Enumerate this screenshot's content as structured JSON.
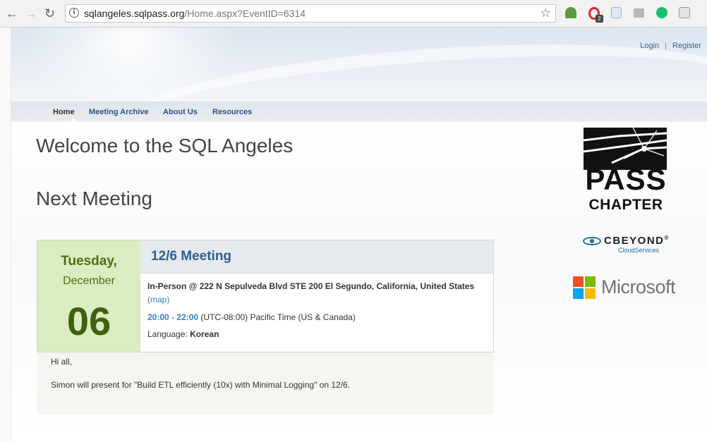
{
  "browser": {
    "url_host": "sqlangeles.sqlpass.org",
    "url_path": "/Home.aspx?EventID=6314",
    "extension_badge": "2",
    "icons": [
      "back-icon",
      "forward-icon",
      "reload-icon",
      "info-icon",
      "star-icon",
      "tree-extension-icon",
      "opera-extension-icon",
      "notepad-extension-icon",
      "drive-extension-icon",
      "grammarly-extension-icon",
      "g-extension-icon"
    ]
  },
  "header": {
    "login": "Login",
    "separator": "|",
    "register": "Register"
  },
  "nav": {
    "items": [
      "Home",
      "Meeting Archive",
      "About Us",
      "Resources"
    ],
    "active": "Home"
  },
  "main": {
    "title": "Welcome to the SQL Angeles",
    "section": "Next Meeting"
  },
  "event": {
    "day_name": "Tuesday,",
    "month": "December",
    "day_num": "06",
    "title": "12/6 Meeting",
    "location": "In-Person @ 222 N Sepulveda Blvd STE 200 El Segundo, California, United States",
    "map_link": "(map)",
    "time_start": "20:00",
    "time_dash": "-",
    "time_end": "22:00",
    "timezone": "(UTC-08:00) Pacific Time (US & Canada)",
    "language_label": "Language:",
    "language": "Korean"
  },
  "description": {
    "greeting": "Hi all,",
    "line1": "Simon will present for \"Build ETL efficiently (10x) with Minimal Logging\" on 12/6."
  },
  "sponsors": {
    "pass_line1": "PASS",
    "pass_line2": "CHAPTER",
    "cbeyond_name": "CBEYOND",
    "cbeyond_mark": "®",
    "cbeyond_sub": "CloudServices",
    "microsoft": "Microsoft"
  },
  "colors": {
    "nav_link": "#2d5484",
    "event_title": "#2f5f94",
    "date_bg": "#d9ecc2",
    "date_text": "#4c6f14",
    "link_blue": "#3b7ec2"
  }
}
